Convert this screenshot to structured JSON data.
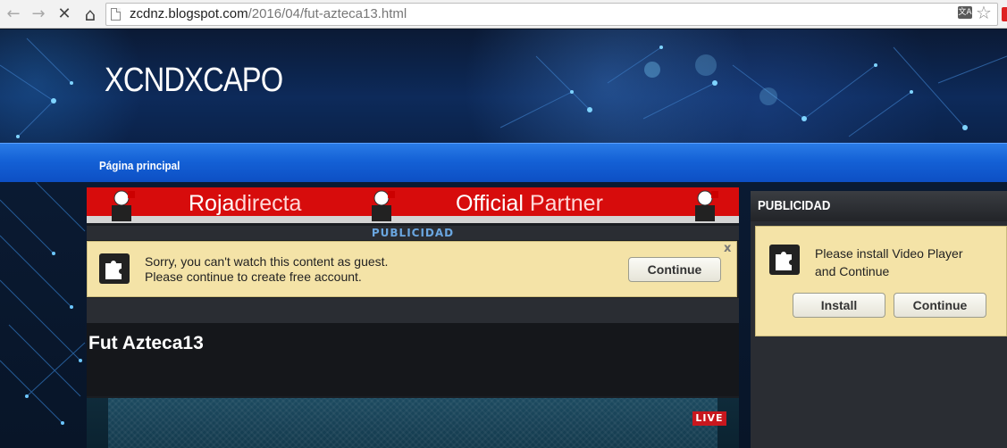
{
  "browser": {
    "url_host": "zcdnz.blogspot.com",
    "url_path": "/2016/04/fut-azteca13.html",
    "back_glyph": "←",
    "forward_glyph": "→",
    "stop_glyph": "✕",
    "home_glyph": "⌂",
    "star_glyph": "☆",
    "translate_glyph": "文A"
  },
  "site": {
    "title": "XCNDXCAPO"
  },
  "nav": {
    "items": [
      {
        "label": "Página principal"
      }
    ]
  },
  "banner": {
    "left_text": "Roja",
    "left_accent": "directa",
    "right_text": "Official ",
    "right_accent": "Partner"
  },
  "ad": {
    "label": "PUBLICIDAD",
    "guest_line1": "Sorry, you can't watch this content as guest.",
    "guest_line2": "Please continue to create free account.",
    "continue_label": "Continue",
    "close_label": "x"
  },
  "post": {
    "title": "Fut Azteca13",
    "live_badge": "LIVE"
  },
  "sidebar": {
    "title": "PUBLICIDAD",
    "message_line1": "Please install Video Player",
    "message_line2": "and Continue",
    "install_label": "Install",
    "continue_label": "Continue"
  },
  "colors": {
    "nav_blue": "#1461d6",
    "banner_red": "#d70c0c",
    "panel_yellow": "#f4e3a7",
    "live_red": "#c8171e"
  },
  "icons": [
    "back-icon",
    "forward-icon",
    "stop-icon",
    "home-icon",
    "page-icon",
    "translate-icon",
    "bookmark-star-icon",
    "puzzle-icon"
  ]
}
